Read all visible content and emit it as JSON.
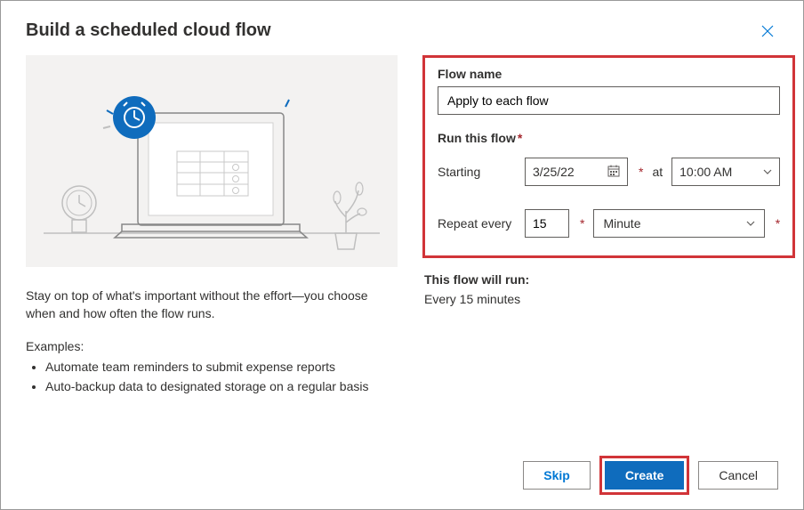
{
  "dialog": {
    "title": "Build a scheduled cloud flow",
    "description": "Stay on top of what's important without the effort—you choose when and how often the flow runs.",
    "examples_label": "Examples:",
    "examples": [
      "Automate team reminders to submit expense reports",
      "Auto-backup data to designated storage on a regular basis"
    ]
  },
  "form": {
    "flow_name_label": "Flow name",
    "flow_name_value": "Apply to each flow",
    "run_label": "Run this flow",
    "starting_label": "Starting",
    "starting_date": "3/25/22",
    "at_label": "at",
    "starting_time": "10:00 AM",
    "repeat_label": "Repeat every",
    "repeat_value": "15",
    "repeat_unit": "Minute"
  },
  "summary": {
    "label": "This flow will run:",
    "text": "Every 15 minutes"
  },
  "footer": {
    "skip": "Skip",
    "create": "Create",
    "cancel": "Cancel"
  }
}
